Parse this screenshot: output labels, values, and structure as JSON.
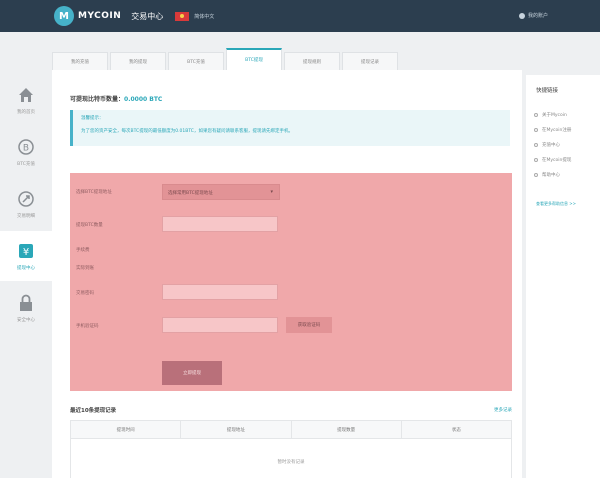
{
  "header": {
    "logo_mark": "M",
    "logo_name": "MYCOIN",
    "logo_sub": "",
    "trade_center": "交易中心",
    "language": "简体中文",
    "user": "我的账户"
  },
  "sidebar": {
    "items": [
      {
        "label": "我的首页",
        "icon": "home-icon",
        "active": false
      },
      {
        "label": "BTC充值",
        "icon": "bitcoin-icon",
        "active": false
      },
      {
        "label": "交易明细",
        "icon": "exchange-icon",
        "active": false
      },
      {
        "label": "提现中心",
        "icon": "yen-icon",
        "active": true
      },
      {
        "label": "安全中心",
        "icon": "lock-icon",
        "active": false
      }
    ]
  },
  "tabs": [
    {
      "label": "我的充值",
      "active": false
    },
    {
      "label": "我的提现",
      "active": false
    },
    {
      "label": "BTC充值",
      "active": false
    },
    {
      "label": "BTC提现",
      "active": true
    },
    {
      "label": "提现规则",
      "active": false
    },
    {
      "label": "提现记录",
      "active": false
    }
  ],
  "main": {
    "balance_label": "可提现比特币数量：",
    "balance_value": "0.0000 BTC",
    "notice_title": "温馨提示：",
    "notice_body": "为了您的资产安全，每次BTC提现的最低额度为0.01BTC，如果您有疑问请联系客服，提现请先绑定手机。",
    "form": {
      "address_label": "选择BTC提现地址",
      "address_select": "选择常用BTC提现地址",
      "amount_label": "提现BTC数量",
      "fee_label": "手续费",
      "actual_label": "实际到账",
      "password_label": "交易密码",
      "sms_label": "手机验证码",
      "sms_button": "获取验证码",
      "submit": "立即提现"
    },
    "records": {
      "title": "最近10条提现记录",
      "more": "更多记录",
      "columns": [
        "提现时间",
        "提现地址",
        "提现数量",
        "状态"
      ],
      "empty": "暂时没有记录"
    }
  },
  "right": {
    "title": "快捷链接",
    "links": [
      "关于Mycoin",
      "在Mycoin注册",
      "充值中心",
      "在Mycoin提现",
      "帮助中心"
    ],
    "more": "查看更多帮助信息 >>"
  }
}
